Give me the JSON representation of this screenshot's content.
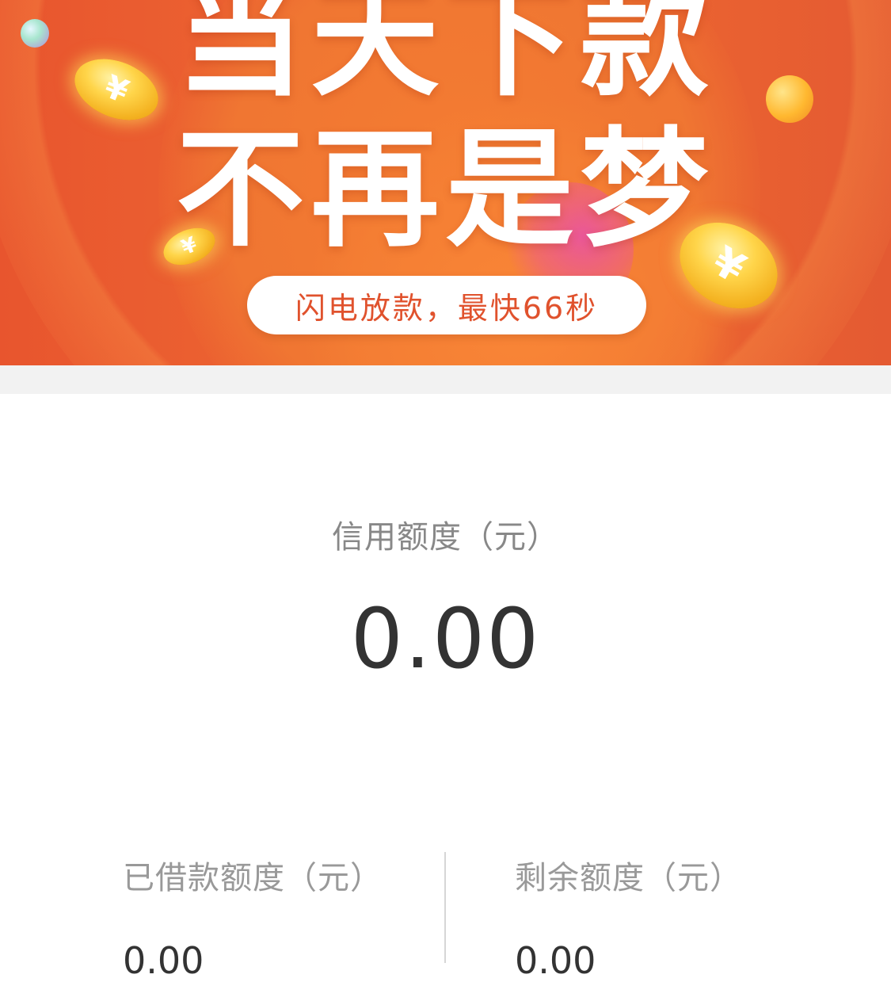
{
  "banner": {
    "headline_line1": "当天下款",
    "headline_line2": "不再是梦",
    "pill_text": "闪电放款，最快66秒",
    "coin_symbol": "¥",
    "colors": {
      "background": "#ec6530",
      "pill_text": "#e0522d",
      "coin": "#f4b221"
    }
  },
  "credit": {
    "label": "信用额度（元）",
    "value": "0.00"
  },
  "summary": {
    "borrowed": {
      "label": "已借款额度（元）",
      "value": "0.00"
    },
    "remaining": {
      "label": "剩余额度（元）",
      "value": "0.00"
    }
  }
}
